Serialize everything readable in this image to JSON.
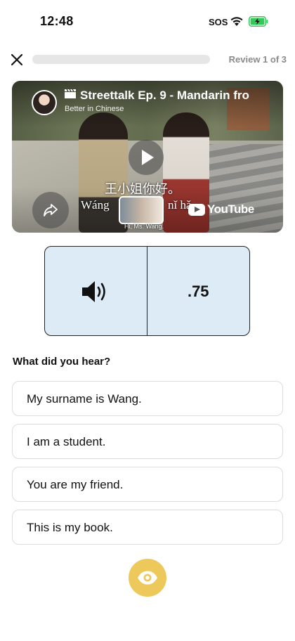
{
  "status_bar": {
    "time": "12:48",
    "sos": "SOS",
    "wifi_icon": "wifi-icon",
    "battery_icon": "battery-charging-icon"
  },
  "top_bar": {
    "close_icon": "close-icon",
    "progress_fraction": 0,
    "review_label": "Review 1 of 3"
  },
  "video": {
    "title": "Streettalk Ep. 9 - Mandarin fro",
    "title_icon": "clapperboard-icon",
    "channel": "Better in Chinese",
    "subtitle_chinese": "王小姐你好。",
    "subtitle_pinyin_left": "Wáng",
    "subtitle_pinyin_right": "nǐ hǎ",
    "thumbnail_caption": "Hi, Ms. Wang.",
    "platform_label": "YouTube",
    "play_icon": "play-icon",
    "share_icon": "share-icon"
  },
  "audio": {
    "play_icon": "speaker-icon",
    "speed_label": ".75"
  },
  "question": "What did you hear?",
  "options": [
    {
      "label": "My surname is Wang."
    },
    {
      "label": "I am a student."
    },
    {
      "label": "You are my friend."
    },
    {
      "label": "This is my book."
    }
  ],
  "reveal": {
    "icon": "eye-icon"
  },
  "colors": {
    "audio_panel_bg": "#dcebf6",
    "reveal_button": "#ecc95a",
    "progress_track": "#e6e6e6",
    "battery_green": "#34c759"
  }
}
